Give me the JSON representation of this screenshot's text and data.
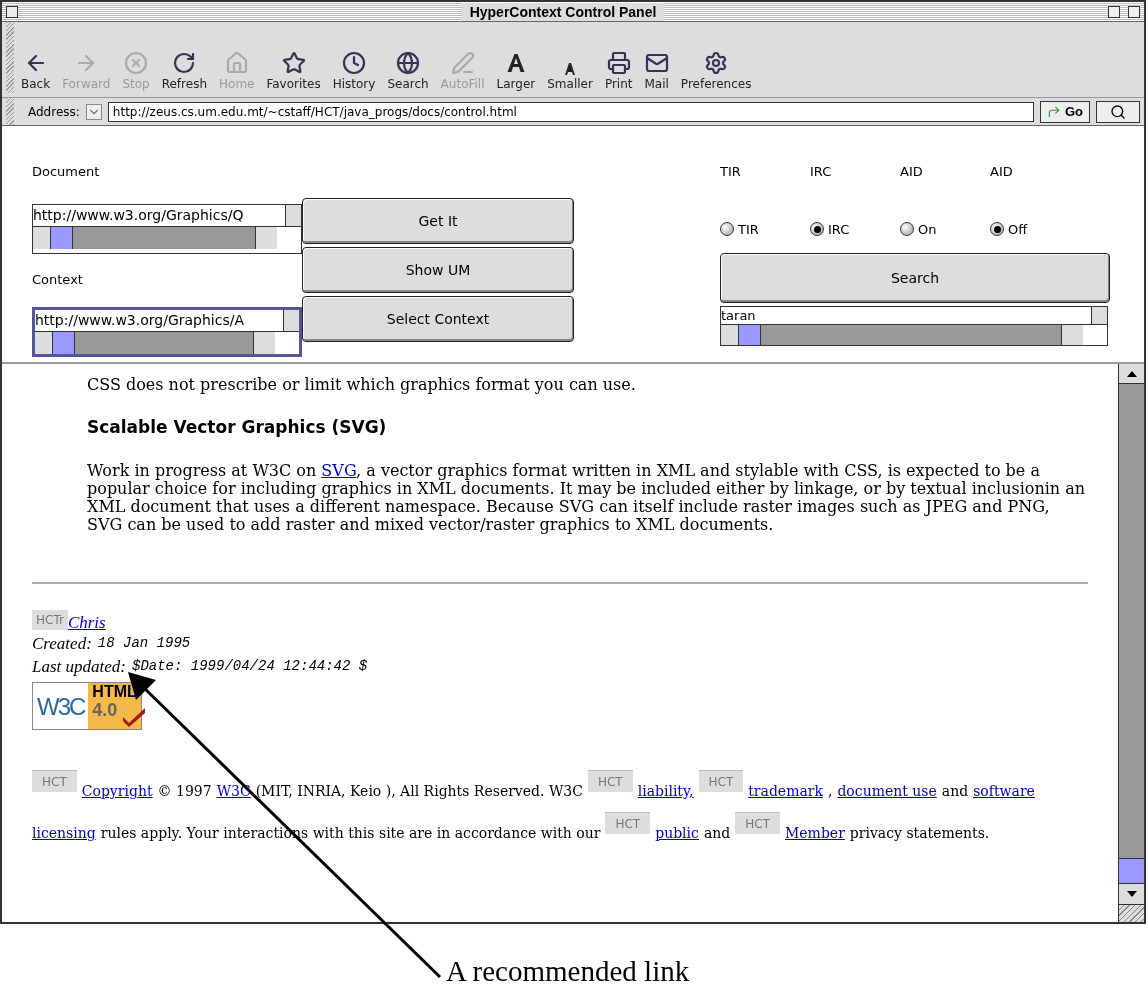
{
  "window": {
    "title": "HyperContext Control Panel"
  },
  "toolbar": [
    {
      "label": "Back",
      "disabled": false
    },
    {
      "label": "Forward",
      "disabled": true
    },
    {
      "label": "Stop",
      "disabled": true
    },
    {
      "label": "Refresh",
      "disabled": false
    },
    {
      "label": "Home",
      "disabled": true
    },
    {
      "label": "Favorites",
      "disabled": false
    },
    {
      "label": "History",
      "disabled": false
    },
    {
      "label": "Search",
      "disabled": false
    },
    {
      "label": "AutoFill",
      "disabled": true
    },
    {
      "label": "Larger",
      "disabled": false
    },
    {
      "label": "Smaller",
      "disabled": false
    },
    {
      "label": "Print",
      "disabled": false
    },
    {
      "label": "Mail",
      "disabled": false
    },
    {
      "label": "Preferences",
      "disabled": false
    }
  ],
  "address": {
    "label": "Address:",
    "value": "http://zeus.cs.um.edu.mt/~cstaff/HCT/java_progs/docs/control.html",
    "go": "Go"
  },
  "form": {
    "document_label": "Document",
    "document_url": "http://www.w3.org/Graphics/Q",
    "context_label": "Context",
    "context_url": "http://www.w3.org/Graphics/A",
    "buttons": [
      "Get It",
      "Show UM",
      "Select Context"
    ],
    "radios": [
      {
        "heading": "TIR",
        "label": "TIR",
        "selected": false
      },
      {
        "heading": "IRC",
        "label": "IRC",
        "selected": true
      },
      {
        "heading": "AID",
        "label": "On",
        "selected": false
      },
      {
        "heading": "AID",
        "label": "Off",
        "selected": true
      }
    ],
    "search_button": "Search",
    "search_value": "taran"
  },
  "content": {
    "first_line": "CSS does not prescribe or limit which graphics format you can use.",
    "heading": "Scalable Vector Graphics (SVG)",
    "paragraph_before": "Work in progress at W3C on",
    "paragraph_link": "SVG",
    "paragraph_after": ", a vector graphics format written in XML and stylable with CSS, is expected to be a popular choice for including graphics in XML documents. It may be included either by linkage, or by textual inclusionin an XML document that uses a different namespace. Because SVG can itself include raster images such as JPEG and PNG, SVG can be used to add raster and mixed vector/raster graphics to XML documents.",
    "signature_badge": "HCTr",
    "signature_link": "Chris",
    "created_label": "Created:",
    "created_value": "18 Jan 1995",
    "updated_label": "Last updated:",
    "updated_value": "$Date: 1999/04/24 12:44:42 $",
    "logo_w3c": "W3C",
    "logo_html": "HTML",
    "logo_version": "4.0",
    "footer_lines": [
      [
        {
          "kind": "badge",
          "text": "HCT"
        },
        {
          "kind": "link",
          "text": "Copyright"
        },
        {
          "kind": "text",
          "text": "© 1997"
        },
        {
          "kind": "link",
          "text": "W3C"
        },
        {
          "kind": "text",
          "text": "(MIT, INRIA, Keio ), All Rights Reserved. W3C"
        },
        {
          "kind": "badge",
          "text": "HCT"
        },
        {
          "kind": "link",
          "text": "liability,"
        },
        {
          "kind": "badge",
          "text": "HCT"
        },
        {
          "kind": "link",
          "text": "trademark"
        },
        {
          "kind": "text",
          "text": ","
        },
        {
          "kind": "link",
          "text": "document use"
        },
        {
          "kind": "text",
          "text": "and"
        },
        {
          "kind": "link",
          "text": "software"
        }
      ],
      [
        {
          "kind": "link",
          "text": "licensing"
        },
        {
          "kind": "text",
          "text": "rules apply. Your interactions with this site are in accordance with our"
        },
        {
          "kind": "badge",
          "text": "HCT"
        },
        {
          "kind": "link",
          "text": "public"
        },
        {
          "kind": "text",
          "text": "and"
        },
        {
          "kind": "badge",
          "text": "HCT"
        },
        {
          "kind": "link",
          "text": "Member"
        },
        {
          "kind": "text",
          "text": "privacy statements."
        }
      ]
    ]
  },
  "annotation": {
    "caption": "A recommended link"
  }
}
